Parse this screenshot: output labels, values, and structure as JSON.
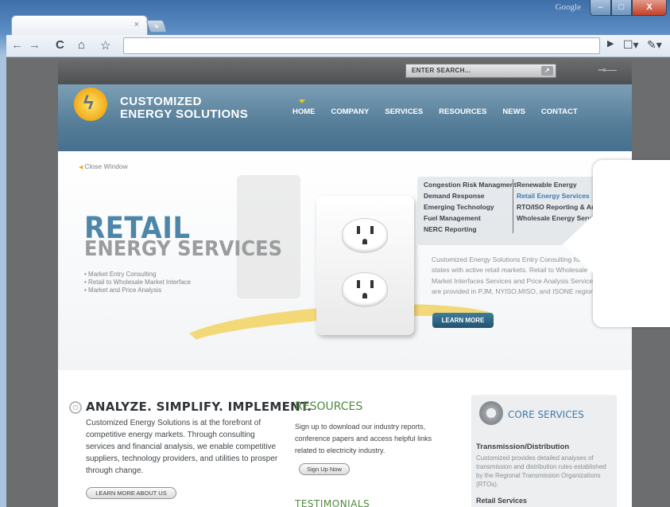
{
  "browser": {
    "titlebar_label": "Google",
    "tab_close": "×",
    "newtab": "+",
    "window_buttons": {
      "minimize": "–",
      "maximize": "□",
      "close": "X"
    },
    "nav": {
      "back": "←",
      "forward": "→",
      "reload": "C",
      "home": "⌂",
      "star": "☆"
    },
    "url": "",
    "toolbar_icons": {
      "play": "▶",
      "page": "☐▾",
      "wrench": "✎▾"
    }
  },
  "site": {
    "search_placeholder": "ENTER SEARCH...",
    "search_btn": "↗",
    "key_icon": "⊸—",
    "logo": {
      "glyph": "ϟ",
      "line1": "CUSTOMIZED",
      "line2": "ENERGY SOLUTIONS"
    },
    "nav": [
      "HOME",
      "COMPANY",
      "SERVICES",
      "RESOURCES",
      "NEWS",
      "CONTACT"
    ],
    "close_window": "Close Window",
    "hero": {
      "title": "RETAIL",
      "subtitle": "ENERGY SERVICES",
      "bullets": [
        "• Market Entry Consulting",
        "• Retail to Wholesale Market Interface",
        "• Market and Price Analysis"
      ],
      "description": "Customized Energy Solutions Entry Consulting for all states with active retail markets. Retail to Wholesale Market Interfaces Services and Price Analysis Services are provided in PJM, NYISO,MISO, and ISONE regions.",
      "learn_more": "LEARN MORE"
    },
    "services_menu": {
      "left": [
        "Congestion Risk Managment",
        "Demand Response",
        "Emerging Technology",
        "Fuel Management",
        "NERC Reporting"
      ],
      "right": [
        "Renewable Energy",
        "Retail Energy Services",
        "RTO/ISO Reporting & Analysis",
        "Wholesale Energy Services"
      ]
    },
    "analyze": {
      "title": "ANALYZE. SIMPLIFY. IMPLEMENT.",
      "text": "Customized Energy Solutions is at the forefront of competitive energy markets. Through consulting services and financial analysis, we enable competitive suppliers, technology providers, and utilities to prosper through change.",
      "button": "LEARN MORE ABOUT US"
    },
    "resources": {
      "title": "RESOURCES",
      "text": "Sign up to download our industry reports, conference papers and access helpful links related to electricity industry.",
      "button": "Sign Up Now",
      "testimonials": "TESTIMONIALS"
    },
    "core": {
      "title": "CORE SERVICES",
      "subtitle": "Transmission/Distribution",
      "text": "Customized provides detailed analyses of transmission and distribution rules established by the Regional Transmission Organizations (RTOs).",
      "more": "Retail Services"
    }
  }
}
